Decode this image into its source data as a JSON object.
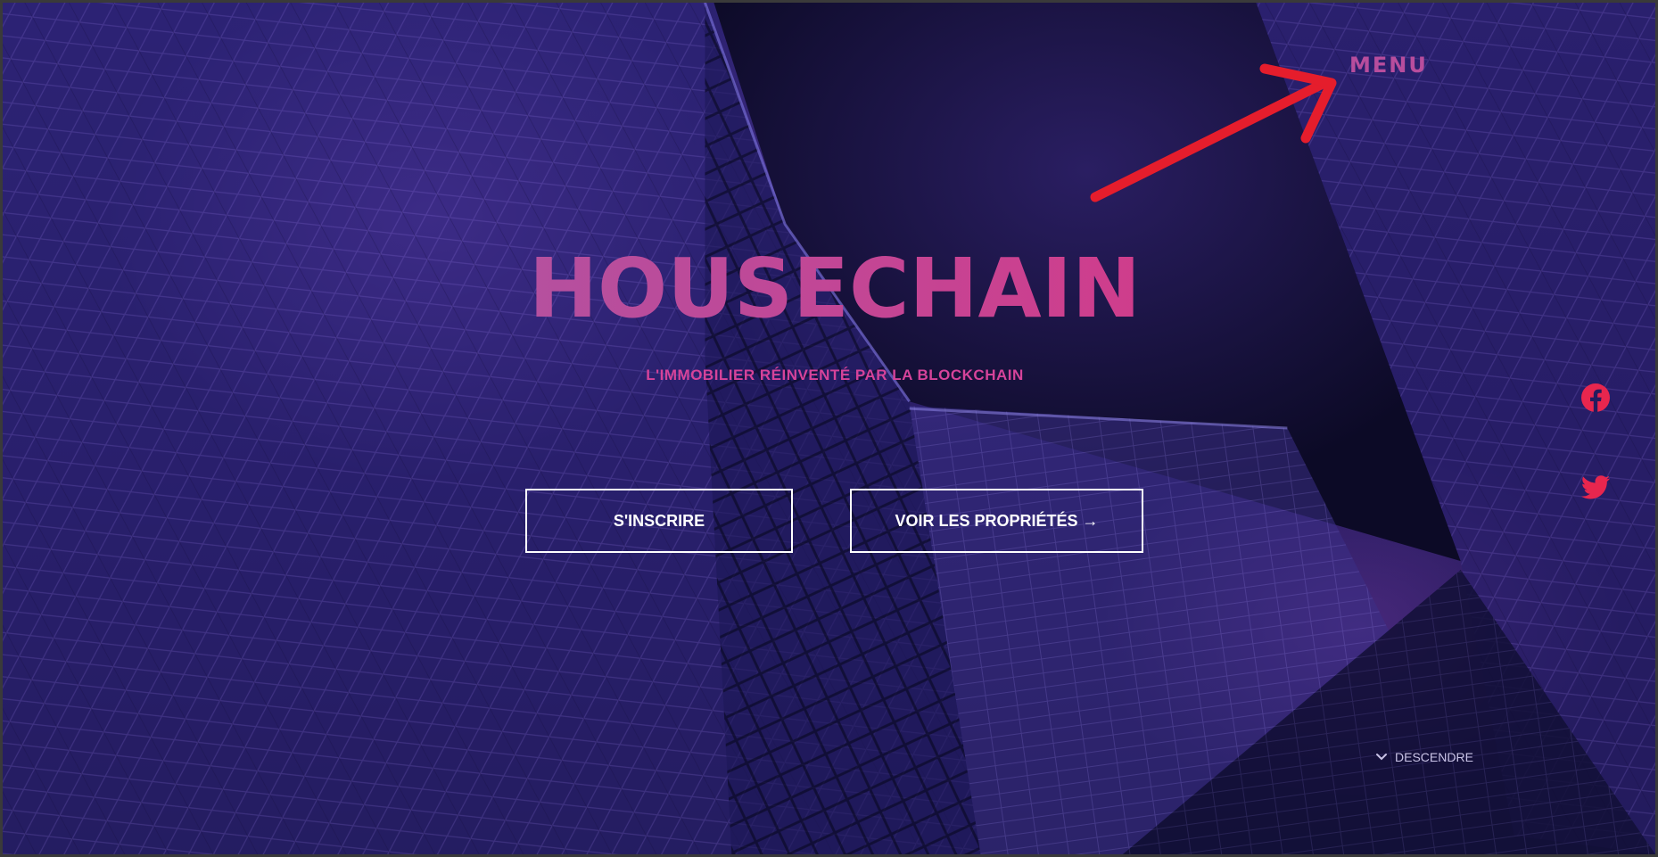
{
  "header": {
    "menu_label": "MENU"
  },
  "hero": {
    "brand_name": "HOUSECHAIN",
    "tagline": "L'IMMOBILIER RÉINVENTÉ PAR LA BLOCKCHAIN",
    "signup_label": "S'INSCRIRE",
    "properties_label": "VOIR LES PROPRIÉTÉS →"
  },
  "social": {
    "facebook_icon": "facebook-icon",
    "twitter_icon": "twitter-icon"
  },
  "scroll": {
    "label": "DESCENDRE",
    "icon": "chevron-down-icon"
  },
  "colors": {
    "brand_pink": "#c0409a",
    "tagline_pink": "#d6439a",
    "social_red": "#e8264e",
    "annotation_red": "#e51d2c",
    "background_purple": "#2b2170"
  }
}
